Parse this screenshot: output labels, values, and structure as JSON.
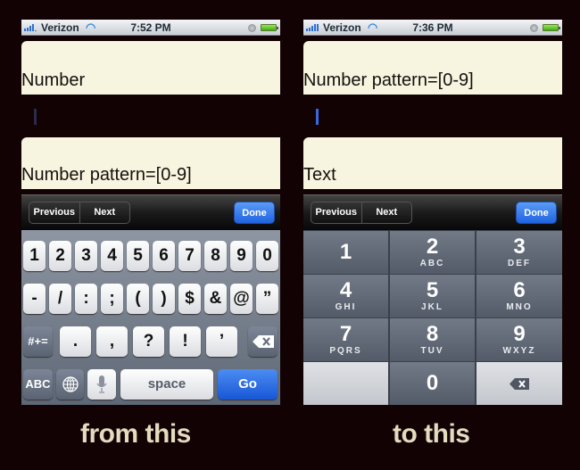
{
  "colors": {
    "background": "#120204",
    "field_bg": "#f7f5df",
    "accent_blue": "#1f63e0",
    "cursor_left": "#2b2c4a",
    "cursor_right": "#3a66e0",
    "caption": "#e3dcbf"
  },
  "left": {
    "status": {
      "carrier": "Verizon",
      "wifi_icon": "wifi-icon",
      "time": "7:52 PM"
    },
    "field_label_top": "Number",
    "field_label_bottom": "Number pattern=[0-9]",
    "toolbar": {
      "previous": "Previous",
      "next": "Next",
      "done": "Done"
    },
    "keyboard": {
      "row1": [
        "1",
        "2",
        "3",
        "4",
        "5",
        "6",
        "7",
        "8",
        "9",
        "0"
      ],
      "row2": [
        "-",
        "/",
        ":",
        ";",
        "(",
        ")",
        "$",
        "&",
        "@",
        "”"
      ],
      "row3": {
        "shift": "#+=",
        "keys": [
          ".",
          ",",
          "?",
          "!",
          "’"
        ],
        "delete_icon": "backspace-icon"
      },
      "row4": {
        "abc": "ABC",
        "globe_icon": "globe-icon",
        "mic_icon": "microphone-icon",
        "space": "space",
        "go": "Go"
      }
    },
    "caption": "from this"
  },
  "right": {
    "status": {
      "carrier": "Verizon",
      "wifi_icon": "wifi-icon",
      "time": "7:36 PM"
    },
    "field_label_top": "Number pattern=[0-9]",
    "field_label_bottom": "Text",
    "toolbar": {
      "previous": "Previous",
      "next": "Next",
      "done": "Done"
    },
    "keypad": [
      {
        "num": "1",
        "letters": ""
      },
      {
        "num": "2",
        "letters": "ABC"
      },
      {
        "num": "3",
        "letters": "DEF"
      },
      {
        "num": "4",
        "letters": "GHI"
      },
      {
        "num": "5",
        "letters": "JKL"
      },
      {
        "num": "6",
        "letters": "MNO"
      },
      {
        "num": "7",
        "letters": "PQRS"
      },
      {
        "num": "8",
        "letters": "TUV"
      },
      {
        "num": "9",
        "letters": "WXYZ"
      },
      {
        "num": "",
        "letters": ""
      },
      {
        "num": "0",
        "letters": ""
      },
      {
        "num": "",
        "letters": "",
        "icon": "backspace-icon"
      }
    ],
    "caption": "to this"
  }
}
